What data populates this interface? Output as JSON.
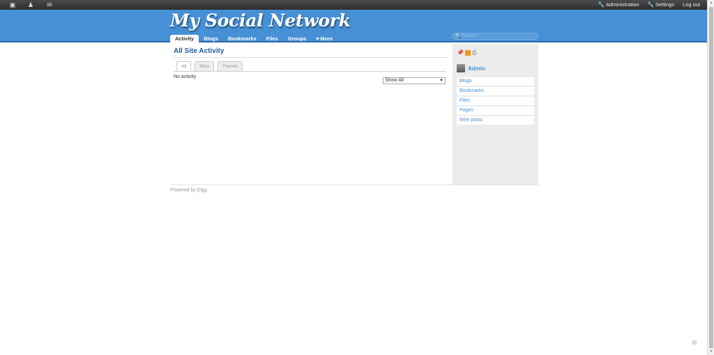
{
  "topbar": {
    "left_icons": [
      "profile-icon",
      "friends-icon",
      "messages-icon"
    ],
    "links": [
      {
        "label": "Administration",
        "icon": "wrench-icon"
      },
      {
        "label": "Settings",
        "icon": "wrench-icon"
      },
      {
        "label": "Log out"
      }
    ]
  },
  "header": {
    "site_title": "My Social Network",
    "nav": [
      "Activity",
      "Blogs",
      "Bookmarks",
      "Files",
      "Groups",
      "▾ More"
    ],
    "active_nav": "Activity",
    "search_placeholder": "Search"
  },
  "main": {
    "heading": "All Site Activity",
    "tabs": [
      "All",
      "Mine",
      "Friends"
    ],
    "active_tab": "All",
    "empty_text": "No activity",
    "filter_select": {
      "selected": "Show All"
    }
  },
  "sidebar": {
    "icons": [
      "pin-icon",
      "rss-icon",
      "print-icon"
    ],
    "owner": "Admin",
    "menu": [
      "Blogs",
      "Bookmarks",
      "Files",
      "Pages",
      "Wire posts"
    ]
  },
  "footer": {
    "text": "Powered by Elgg"
  }
}
